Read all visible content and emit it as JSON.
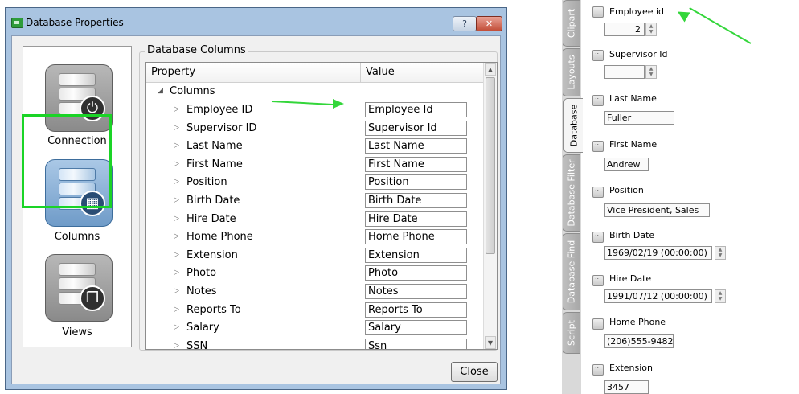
{
  "dialog": {
    "title": "Database Properties",
    "help_btn": "?",
    "close_btn": "✕",
    "nav": [
      {
        "label": "Connection",
        "glyph": "⏻"
      },
      {
        "label": "Columns",
        "glyph": "▦"
      },
      {
        "label": "Views",
        "glyph": "❐"
      }
    ],
    "group_title": "Database Columns",
    "grid": {
      "head_property": "Property",
      "head_value": "Value",
      "root_label": "Columns",
      "rows": [
        {
          "prop": "Employee ID",
          "value": "Employee Id"
        },
        {
          "prop": "Supervisor ID",
          "value": "Supervisor Id"
        },
        {
          "prop": "Last Name",
          "value": "Last Name"
        },
        {
          "prop": "First Name",
          "value": "First Name"
        },
        {
          "prop": "Position",
          "value": "Position"
        },
        {
          "prop": "Birth Date",
          "value": "Birth Date"
        },
        {
          "prop": "Hire Date",
          "value": "Hire Date"
        },
        {
          "prop": "Home Phone",
          "value": "Home Phone"
        },
        {
          "prop": "Extension",
          "value": "Extension"
        },
        {
          "prop": "Photo",
          "value": "Photo"
        },
        {
          "prop": "Notes",
          "value": "Notes"
        },
        {
          "prop": "Reports To",
          "value": "Reports To"
        },
        {
          "prop": "Salary",
          "value": "Salary"
        },
        {
          "prop": "SSN",
          "value": "Ssn"
        }
      ]
    },
    "close_label": "Close"
  },
  "panel": {
    "tabs": [
      "Clipart",
      "Layouts",
      "Database",
      "Database Filter",
      "Database Find",
      "Script"
    ],
    "active_tab": "Database",
    "fields": [
      {
        "label": "Employee id",
        "value": "2"
      },
      {
        "label": "Supervisor Id",
        "value": ""
      },
      {
        "label": "Last Name",
        "value": "Fuller"
      },
      {
        "label": "First Name",
        "value": "Andrew"
      },
      {
        "label": "Position",
        "value": "Vice President, Sales"
      },
      {
        "label": "Birth Date",
        "value": "1969/02/19 (00:00:00)"
      },
      {
        "label": "Hire Date",
        "value": "1991/07/12 (00:00:00)"
      },
      {
        "label": "Home Phone",
        "value": "(206)555-9482"
      },
      {
        "label": "Extension",
        "value": "3457"
      }
    ]
  },
  "colors": {
    "annotation_green": "#33d63a",
    "selection_green": "#1ad426",
    "titlebar_blue": "#a9c4e1"
  }
}
